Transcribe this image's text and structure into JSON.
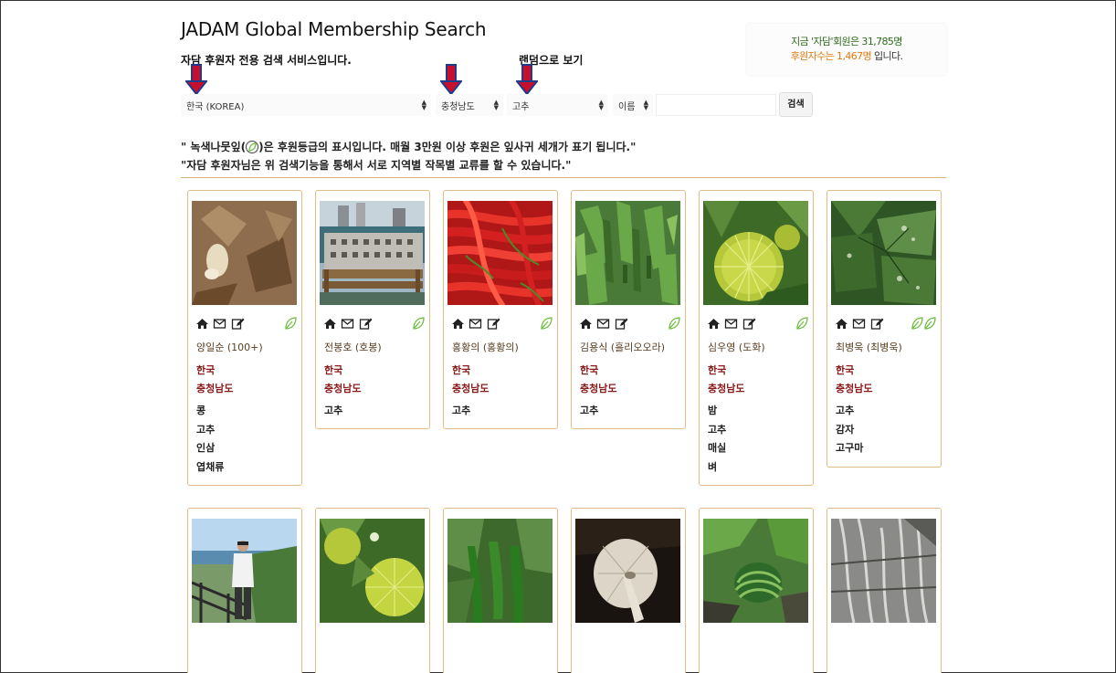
{
  "header": {
    "title": "JADAM Global Membership Search",
    "subtitle": "자담 후원자 전용 검색 서비스입니다.",
    "random_link": "랜덤으로 보기"
  },
  "stats": {
    "line1": "지금 '자담'회원은 31,785명",
    "line2_highlight": "후원자수는 1,467명",
    "line2_tail": " 입니다."
  },
  "filters": {
    "country": "한국 (KOREA)",
    "region": "충청남도",
    "crop": "고추",
    "field": "이름",
    "name_value": "",
    "search_label": "검색"
  },
  "notes": {
    "line1_before": "\" 녹색나뭇잎(",
    "line1_after": ")은 후원등급의 표시입니다. 매월 3만원 이상 후원은 잎사귀 세개가 표기 됩니다.\"",
    "line2": "\"자담 후원자님은 위 검색기능을 통해서 서로 지역별 작목별 교류를 할 수 있습니다.\""
  },
  "colors": {
    "card_border": "#e3bc87",
    "leaf_green": "#6cbf3c",
    "country_color": "#8a1a1a",
    "stats_green": "#2e6b1c",
    "stats_orange": "#e07a10",
    "arrow_red": "#c8102e",
    "arrow_blue": "#1f3b8c"
  },
  "icons": [
    "home-icon",
    "mail-icon",
    "edit-icon",
    "leaf-icon"
  ],
  "members": [
    {
      "name": "양일순 (100+)",
      "country": "한국",
      "region": "충청남도",
      "crops": [
        "콩",
        "고추",
        "인삼",
        "엽채류"
      ],
      "leaves": 1,
      "photo": "mushroom"
    },
    {
      "name": "전봉호 (호봉)",
      "country": "한국",
      "region": "충청남도",
      "crops": [
        "고추"
      ],
      "leaves": 1,
      "photo": "crate"
    },
    {
      "name": "홍황의 (홍황의)",
      "country": "한국",
      "region": "충청남도",
      "crops": [
        "고추"
      ],
      "leaves": 1,
      "photo": "redpepper"
    },
    {
      "name": "김용식 (흘리오오라)",
      "country": "한국",
      "region": "충청남도",
      "crops": [
        "고추"
      ],
      "leaves": 1,
      "photo": "greenpepper"
    },
    {
      "name": "심우영 (도화)",
      "country": "한국",
      "region": "충청남도",
      "crops": [
        "밤",
        "고추",
        "매실",
        "벼"
      ],
      "leaves": 1,
      "photo": "chestnut"
    },
    {
      "name": "최병욱 (최병욱)",
      "country": "한국",
      "region": "충청남도",
      "crops": [
        "고추",
        "감자",
        "고구마"
      ],
      "leaves": 2,
      "photo": "leaves"
    }
  ],
  "members_row2": [
    {
      "photo": "person"
    },
    {
      "photo": "chestnut2"
    },
    {
      "photo": "greenpepper2"
    },
    {
      "photo": "mushroom2"
    },
    {
      "photo": "watermelon"
    },
    {
      "photo": "roots"
    }
  ]
}
